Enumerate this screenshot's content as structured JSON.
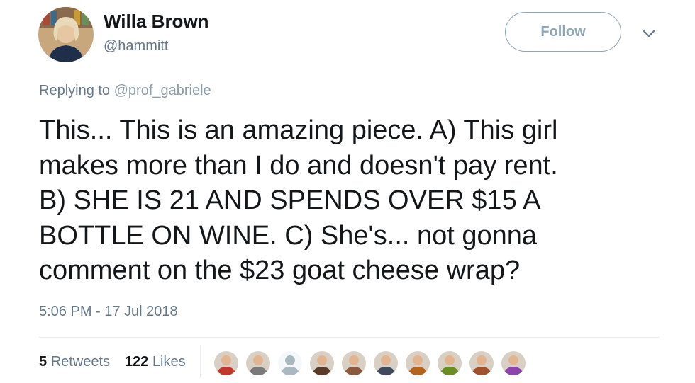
{
  "user": {
    "name": "Willa Brown",
    "handle": "@hammitt",
    "avatar_icon": "profile-photo-woman-bookshelf"
  },
  "follow_label": "Follow",
  "menu_icon": "chevron-down-icon",
  "reply": {
    "prefix": "Replying to",
    "mention": "@prof_gabriele"
  },
  "tweet": {
    "lines": [
      "This... This is an amazing piece. A) This girl",
      "makes more than I do and doesn't pay rent.",
      "B) SHE IS 21 AND SPENDS OVER $15 A",
      "BOTTLE ON WINE. C) She's... not gonna",
      "comment on the $23 goat cheese wrap?"
    ]
  },
  "timestamp": "5:06 PM - 17 Jul 2018",
  "stats": {
    "retweets_count": "5",
    "retweets_label": "Retweets",
    "likes_count": "122",
    "likes_label": "Likes"
  },
  "likers": [
    {
      "icon": "liker-avatar-1",
      "color": "#c0392b"
    },
    {
      "icon": "liker-avatar-2",
      "color": "#7a7a7a"
    },
    {
      "icon": "default-avatar-icon",
      "color": "#aab8c2"
    },
    {
      "icon": "liker-avatar-4",
      "color": "#5a3b2a"
    },
    {
      "icon": "liker-avatar-5",
      "color": "#8b5a3c"
    },
    {
      "icon": "liker-avatar-6",
      "color": "#3f4a5c"
    },
    {
      "icon": "liker-avatar-7",
      "color": "#b5651d"
    },
    {
      "icon": "liker-avatar-8",
      "color": "#6b8e23"
    },
    {
      "icon": "liker-avatar-9",
      "color": "#a0522d"
    },
    {
      "icon": "liker-avatar-10",
      "color": "#8e44ad"
    }
  ],
  "colors": {
    "text": "#14171a",
    "secondary": "#657786",
    "follow_border": "#8ea6b8",
    "divider": "#e6ecf0"
  }
}
